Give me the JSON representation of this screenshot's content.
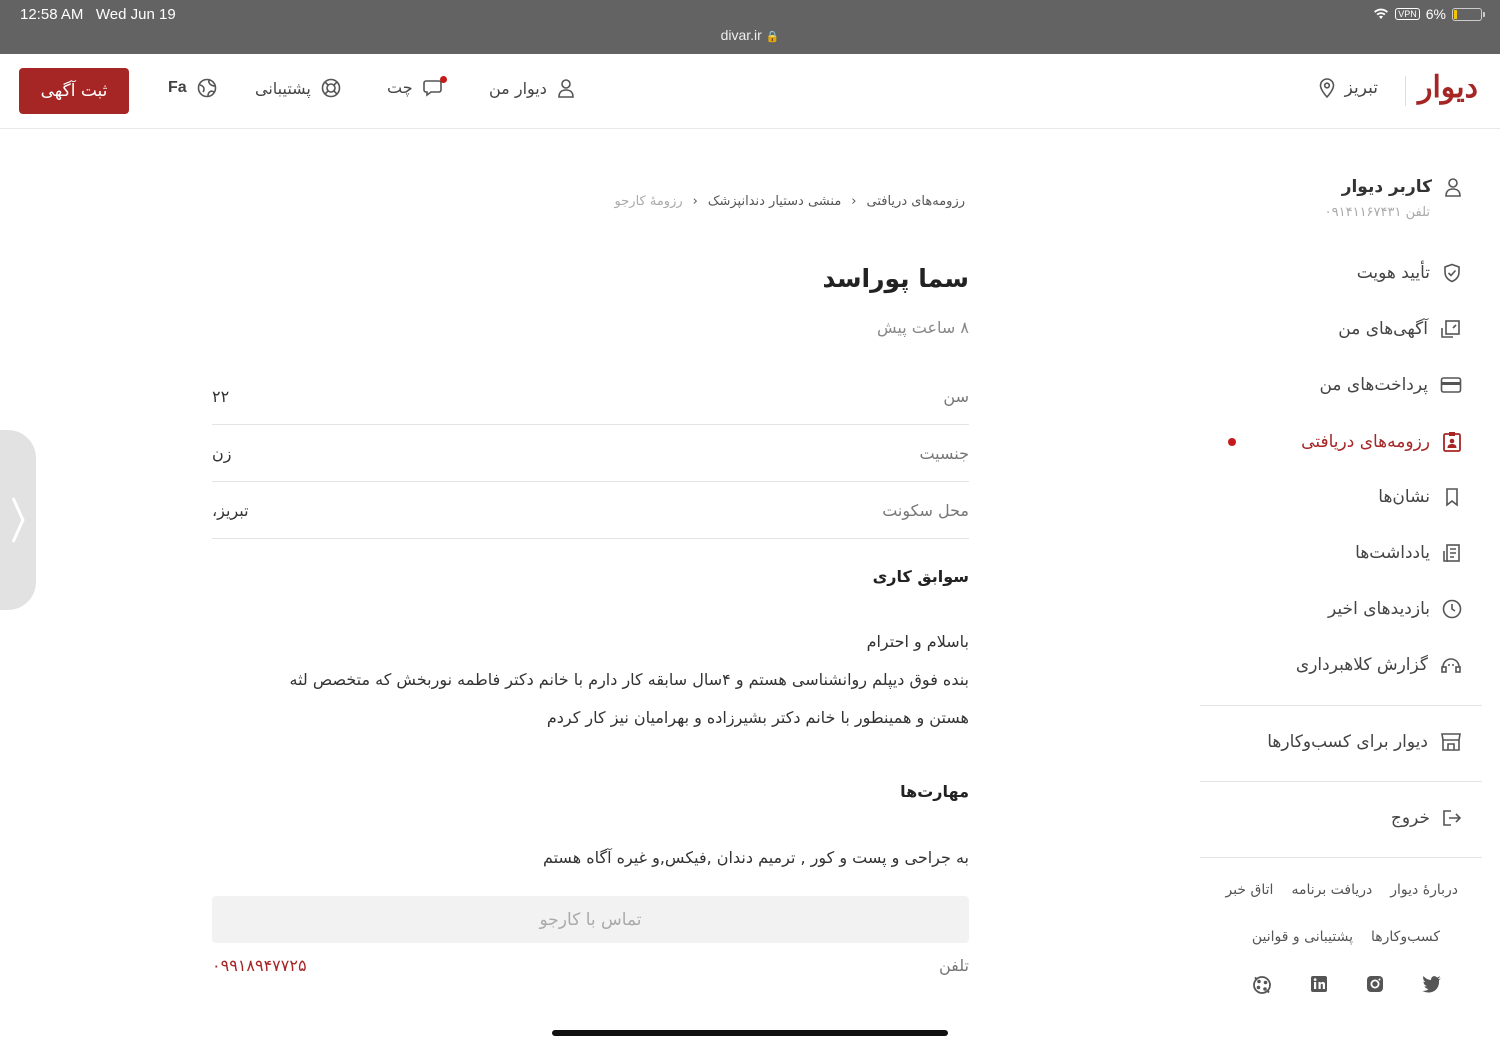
{
  "status_bar": {
    "time": "12:58 AM",
    "date": "Wed Jun 19",
    "url": "divar.ir",
    "vpn": "VPN",
    "battery": "6%"
  },
  "header": {
    "logo": "دیوار",
    "city": "تبریز",
    "my_divar": "دیوار من",
    "chat": "چت",
    "support": "پشتیبانی",
    "lang": "Fa",
    "post_button": "ثبت آگهی"
  },
  "sidebar": {
    "user_name": "کاربر دیوار",
    "user_phone": "تلفن ۰۹۱۴۱۱۶۷۴۳۱",
    "items": [
      {
        "label": "تأیید هویت",
        "icon": "shield-check-icon"
      },
      {
        "label": "آگهی‌های من",
        "icon": "my-ads-icon"
      },
      {
        "label": "پرداخت‌های من",
        "icon": "card-icon"
      },
      {
        "label": "رزومه‌های دریافتی",
        "icon": "resume-icon",
        "active": true
      },
      {
        "label": "نشان‌ها",
        "icon": "bookmark-icon"
      },
      {
        "label": "یادداشت‌ها",
        "icon": "notes-icon"
      },
      {
        "label": "بازدیدهای اخیر",
        "icon": "clock-icon"
      },
      {
        "label": "گزارش کلاهبرداری",
        "icon": "fraud-report-icon"
      }
    ],
    "business": "دیوار برای کسب‌وکارها",
    "logout": "خروج",
    "footer_row1": [
      "دربارهٔ دیوار",
      "دریافت برنامه",
      "اتاق خبر"
    ],
    "footer_row2": [
      "کسب‌وکارها",
      "پشتیبانی و قوانین"
    ]
  },
  "main": {
    "breadcrumb": [
      "رزومه‌های دریافتی",
      "منشی دستیار دندانپزشک",
      "رزومهٔ کارجو"
    ],
    "name": "سما پوراسد",
    "time_ago": "۸ ساعت پیش",
    "info": [
      {
        "label": "سن",
        "value": "۲۲"
      },
      {
        "label": "جنسیت",
        "value": "زن"
      },
      {
        "label": "محل سکونت",
        "value": "تبریز،"
      }
    ],
    "experience_title": "سوابق کاری",
    "experience_lines": [
      "باسلام و احترام",
      "بنده فوق دیپلم روانشناسی هستم و ۴سال سابقه کار دارم با خانم دکتر فاطمه نوربخش که متخصص لثه",
      "هستن و همینطور با خانم دکتر بشیرزاده و بهرامیان نیز کار کردم"
    ],
    "skills_title": "مهارت‌ها",
    "skills_text": "به جراحی و پست و کور , ترمیم دندان ,فیکس,و غیره آگاه هستم",
    "contact_button": "تماس با کارجو",
    "phone_label": "تلفن",
    "phone_value": "۰۹۹۱۸۹۴۷۷۲۵"
  }
}
